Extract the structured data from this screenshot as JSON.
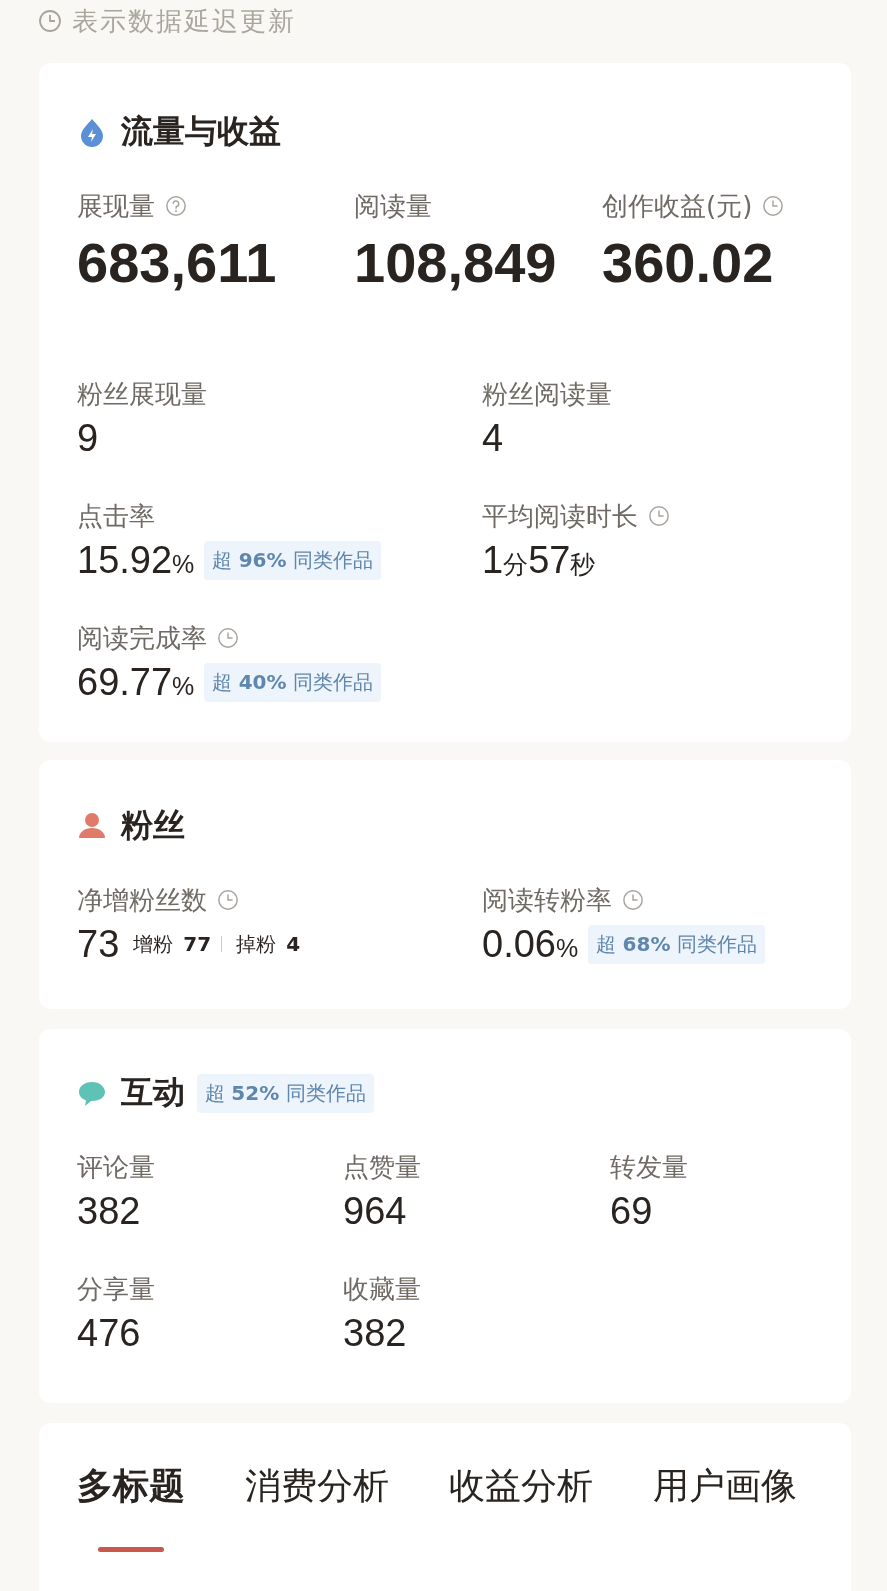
{
  "notice": {
    "text": "表示数据延迟更新",
    "delayed": true
  },
  "sections": [
    {
      "kind": "traffic",
      "title": "流量与收益",
      "headline": [
        {
          "label": "展现量",
          "help": true,
          "delayed": false,
          "value": [
            {
              "text": "683,611",
              "unit": false
            }
          ]
        },
        {
          "label": "阅读量",
          "help": false,
          "delayed": false,
          "value": [
            {
              "text": "108,849",
              "unit": false
            }
          ]
        },
        {
          "label": "创作收益(元)",
          "help": false,
          "delayed": true,
          "value": [
            {
              "text": "360.02",
              "unit": false
            }
          ]
        }
      ],
      "metrics": [
        {
          "label": "粉丝展现量",
          "delayed": false,
          "value": [
            {
              "text": "9",
              "unit": false
            }
          ]
        },
        {
          "label": "粉丝阅读量",
          "delayed": false,
          "value": [
            {
              "text": "4",
              "unit": false
            }
          ]
        },
        {
          "label": "点击率",
          "delayed": false,
          "value": [
            {
              "text": "15.92",
              "unit": false
            },
            {
              "text": "%",
              "unit": true
            }
          ],
          "badge": "超 **96%** 同类作品"
        },
        {
          "label": "平均阅读时长",
          "delayed": true,
          "value": [
            {
              "text": "1",
              "unit": false
            },
            {
              "text": "分",
              "unit": true
            },
            {
              "text": "57",
              "unit": false
            },
            {
              "text": "秒",
              "unit": true
            }
          ]
        },
        {
          "label": "阅读完成率",
          "delayed": true,
          "value": [
            {
              "text": "69.77",
              "unit": false
            },
            {
              "text": "%",
              "unit": true
            }
          ],
          "badge": "超 **40%** 同类作品"
        }
      ]
    },
    {
      "kind": "fans",
      "title": "粉丝",
      "metrics": [
        {
          "label": "净增粉丝数",
          "delayed": true,
          "value": [
            {
              "text": "73",
              "unit": false
            }
          ],
          "breakdown": [
            {
              "label": "增粉",
              "value": "77"
            },
            {
              "label": "掉粉",
              "value": "4"
            }
          ]
        },
        {
          "label": "阅读转粉率",
          "delayed": true,
          "value": [
            {
              "text": "0.06",
              "unit": false
            },
            {
              "text": "%",
              "unit": true
            }
          ],
          "badge": "超 **68%** 同类作品"
        }
      ]
    },
    {
      "kind": "interaction",
      "title": "互动",
      "badge": "超 **52%** 同类作品",
      "metrics": [
        {
          "label": "评论量",
          "delayed": false,
          "value": [
            {
              "text": "382",
              "unit": false
            }
          ]
        },
        {
          "label": "点赞量",
          "delayed": false,
          "value": [
            {
              "text": "964",
              "unit": false
            }
          ]
        },
        {
          "label": "转发量",
          "delayed": false,
          "value": [
            {
              "text": "69",
              "unit": false
            }
          ]
        },
        {
          "label": "分享量",
          "delayed": false,
          "value": [
            {
              "text": "476",
              "unit": false
            }
          ]
        },
        {
          "label": "收藏量",
          "delayed": false,
          "value": [
            {
              "text": "382",
              "unit": false
            }
          ]
        }
      ]
    }
  ],
  "tabs": [
    {
      "label": "多标题",
      "selected": true
    },
    {
      "label": "消费分析",
      "selected": false
    },
    {
      "label": "收益分析",
      "selected": false
    },
    {
      "label": "用户画像",
      "selected": false
    }
  ]
}
